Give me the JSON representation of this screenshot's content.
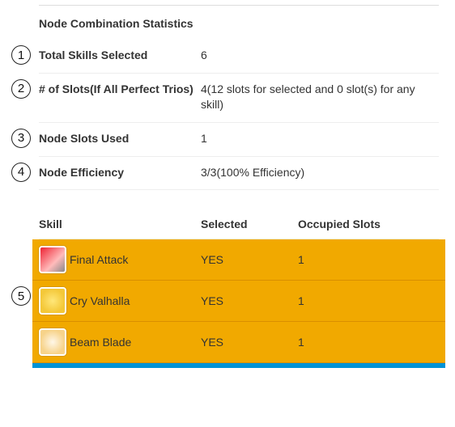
{
  "title": "Node Combination Statistics",
  "stats": [
    {
      "num": "1",
      "label": "Total Skills Selected",
      "value": "6"
    },
    {
      "num": "2",
      "label": "# of Slots(If All Perfect Trios)",
      "value": "4(12 slots for selected and 0 slot(s) for any skill)"
    },
    {
      "num": "3",
      "label": "Node Slots Used",
      "value": "1"
    },
    {
      "num": "4",
      "label": "Node Efficiency",
      "value": "3/3(100% Efficiency)"
    }
  ],
  "tableHead": {
    "skill": "Skill",
    "selected": "Selected",
    "occupied": "Occupied Slots"
  },
  "groupNum": "5",
  "skills": [
    {
      "name": "Final Attack",
      "selected": "YES",
      "slots": "1",
      "iconClass": "final-attack-bg"
    },
    {
      "name": "Cry Valhalla",
      "selected": "YES",
      "slots": "1",
      "iconClass": "cry-valhalla-bg"
    },
    {
      "name": "Beam Blade",
      "selected": "YES",
      "slots": "1",
      "iconClass": "beam-blade-bg"
    }
  ]
}
